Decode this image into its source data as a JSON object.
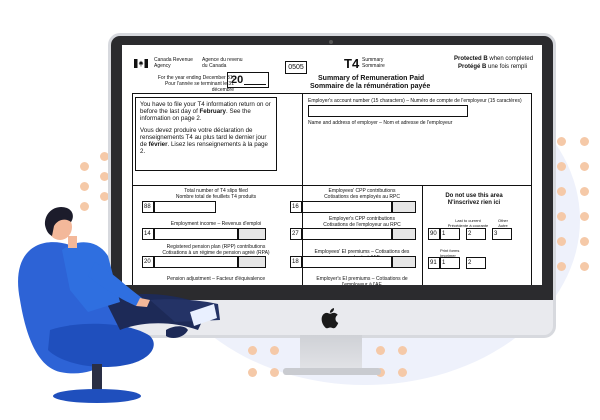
{
  "form": {
    "agency_en": "Canada Revenue\nAgency",
    "agency_fr": "Agence du revenu\ndu Canada",
    "year_label_en": "For the year ending December 31,",
    "year_label_fr": "Pour l'année se terminant le 31 décembre",
    "year_prefix": "20",
    "form_code": "0505",
    "t4": "T4",
    "t4_sub": "Summary\nSommaire",
    "summary_en": "Summary of Remuneration Paid",
    "summary_fr": "Sommaire de la rémunération payée",
    "protected_b_en": "Protected B",
    "protected_b_en_suffix": " when completed",
    "protected_b_fr": "Protégé B",
    "protected_b_fr_suffix": " une fois rempli",
    "notice_en_1": "You have to file your T4 information return on or before the last day of ",
    "notice_en_bold": "February",
    "notice_en_2": ". See the information on page 2.",
    "notice_fr_1": "Vous devez produire votre déclaration de renseignements T4 au plus tard le dernier jour de ",
    "notice_fr_bold": "février",
    "notice_fr_2": ". Lisez les renseignements à la page 2.",
    "employer_account_label": "Employer's account number (15 characters) – Numéro de compte de l'employeur (15 caractères)",
    "employer_name_label": "Name and address of employer – Nom et adresse de l'employeur",
    "fields_left": [
      {
        "label_en": "Total number of T4 slips filed",
        "label_fr": "Nombre total de feuillets T4 produits",
        "code": "88"
      },
      {
        "label_en": "Employment income – Revenus d'emploi",
        "label_fr": "",
        "code": "14"
      },
      {
        "label_en": "Registered pension plan (RPP) contributions",
        "label_fr": "Cotisations à un régime de pension agréé (RPA)",
        "code": "20"
      },
      {
        "label_en": "Pension adjustment – Facteur d'équivalence",
        "label_fr": "",
        "code": ""
      }
    ],
    "fields_mid": [
      {
        "label_en": "Employees' CPP contributions",
        "label_fr": "Cotisations des employés au RPC",
        "code": "16"
      },
      {
        "label_en": "Employer's CPP contributions",
        "label_fr": "Cotisations de l'employeur au RPC",
        "code": "27"
      },
      {
        "label_en": "Employees' EI premiums – Cotisations des employés à l'AE",
        "label_fr": "",
        "code": "18"
      },
      {
        "label_en": "Employer's EI premiums – Cotisations de l'employeur à l'AE",
        "label_fr": "",
        "code": ""
      }
    ],
    "no_use_en": "Do not use this area",
    "no_use_fr": "N'inscrivez rien ici",
    "no_use_cols": [
      "Last to current\nPrécédente à courante",
      "Other\nAutre"
    ],
    "no_use_row1": {
      "code": "90",
      "a": "1",
      "b": "2",
      "c": "3"
    },
    "print_label": "Print forms\nImprimer",
    "no_use_row2": {
      "code": "91",
      "a": "1",
      "b": "2"
    }
  }
}
